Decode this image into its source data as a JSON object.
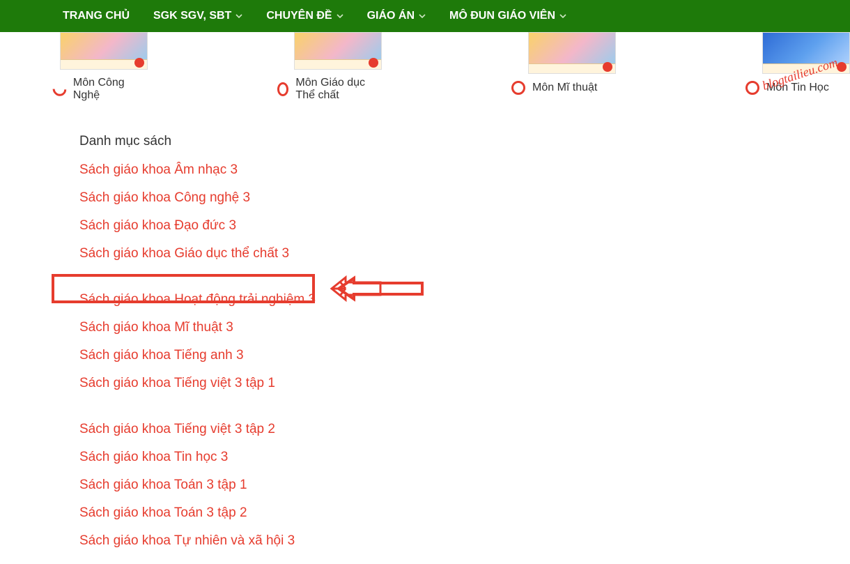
{
  "nav": {
    "items": [
      {
        "label": "TRANG CHỦ",
        "has_chevron": false
      },
      {
        "label": "SGK SGV, SBT",
        "has_chevron": true
      },
      {
        "label": "CHUYÊN ĐỀ",
        "has_chevron": true
      },
      {
        "label": "GIÁO ÁN",
        "has_chevron": true
      },
      {
        "label": "MÔ ĐUN GIÁO VIÊN",
        "has_chevron": true
      }
    ]
  },
  "subjects": [
    {
      "label": "Môn Công Nghệ",
      "radio_style": "partial",
      "thumb": "default"
    },
    {
      "label": "Môn Giáo dục Thể chất",
      "radio_style": "full",
      "thumb": "default"
    },
    {
      "label": "Môn Mĩ thuật",
      "radio_style": "full",
      "thumb": "default"
    },
    {
      "label": "Môn Tin Học",
      "radio_style": "full",
      "thumb": "blue"
    }
  ],
  "watermark": "blogtailieu.com",
  "book_list": {
    "heading": "Danh mục sách",
    "items": [
      {
        "label": "Sách giáo khoa Âm nhạc 3"
      },
      {
        "label": "Sách giáo khoa Công nghệ 3"
      },
      {
        "label": "Sách giáo khoa Đạo đức 3"
      },
      {
        "label": "Sách giáo khoa Giáo dục thể chất 3",
        "spaced_after": true
      },
      {
        "label": "Sách giáo khoa Hoạt động trải nghiệm 3",
        "highlighted": true
      },
      {
        "label": "Sách giáo khoa Mĩ thuật 3"
      },
      {
        "label": "Sách giáo khoa Tiếng anh 3"
      },
      {
        "label": "Sách giáo khoa Tiếng việt 3 tập 1",
        "spaced_after": true
      },
      {
        "label": "Sách giáo khoa Tiếng việt 3 tập 2"
      },
      {
        "label": "Sách giáo khoa Tin học 3"
      },
      {
        "label": "Sách giáo khoa Toán 3 tập 1"
      },
      {
        "label": "Sách giáo khoa Toán 3 tập 2"
      },
      {
        "label": "Sách giáo khoa Tự nhiên và xã hội 3"
      }
    ]
  }
}
